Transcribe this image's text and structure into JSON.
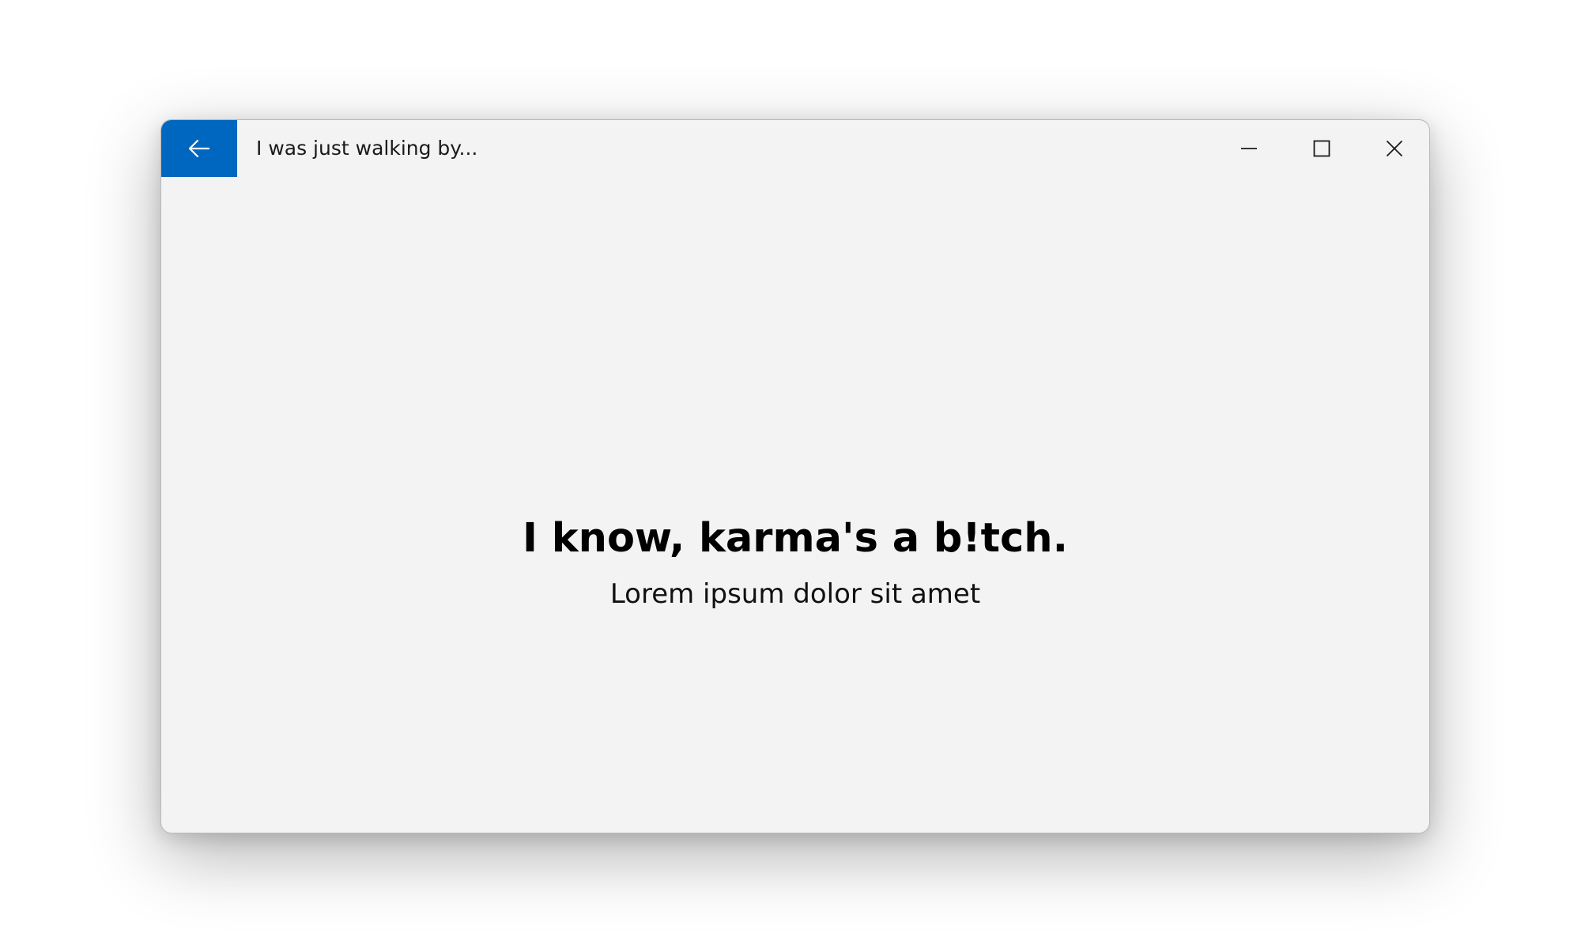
{
  "window": {
    "title": "I was just walking by...",
    "accent_color": "#0067c0",
    "background_color": "#f3f3f3"
  },
  "titlebar": {
    "back_icon": "arrow-left-icon",
    "minimize_icon": "minimize-icon",
    "maximize_icon": "maximize-icon",
    "close_icon": "close-icon"
  },
  "main": {
    "headline": "I know, karma's a b!tch.",
    "subtitle": "Lorem ipsum dolor sit amet"
  }
}
